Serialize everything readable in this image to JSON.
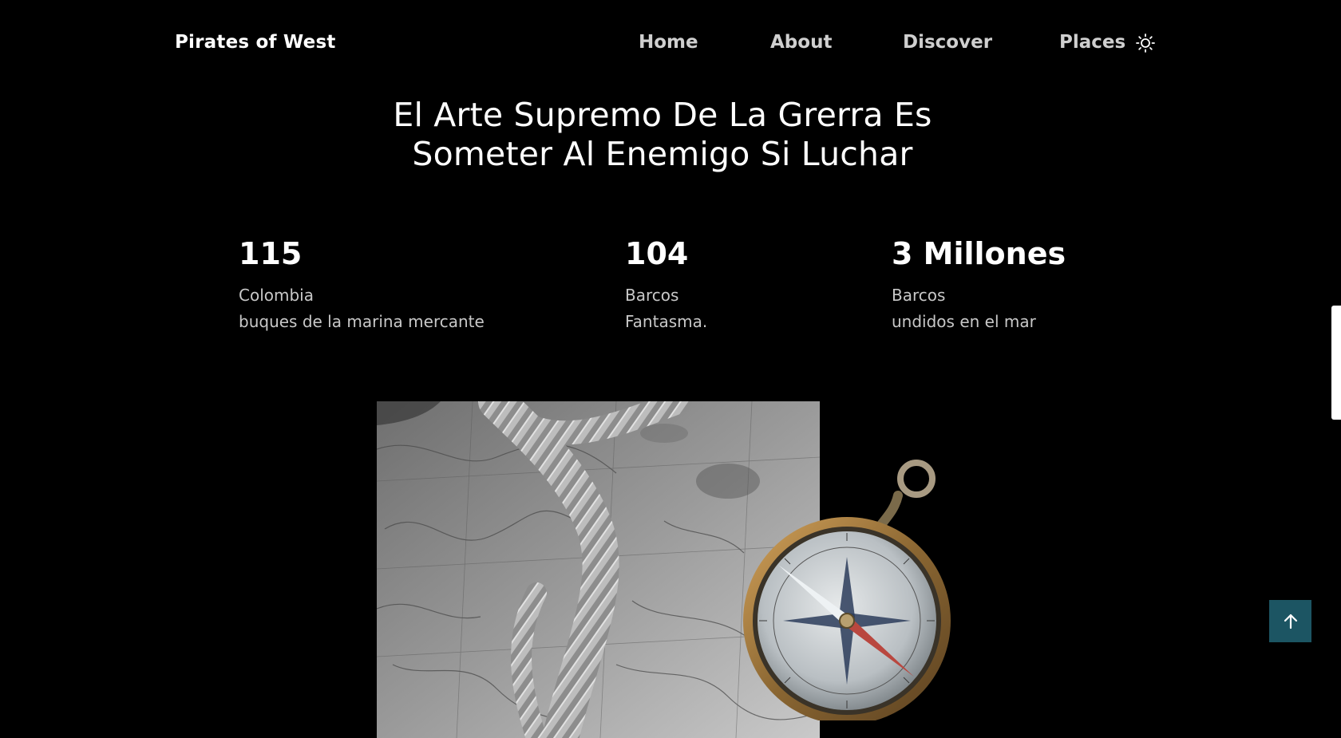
{
  "header": {
    "logo": "Pirates of West",
    "nav": {
      "home": "Home",
      "about": "About",
      "discover": "Discover",
      "places": "Places"
    },
    "theme_icon": "sun-icon"
  },
  "hero": {
    "title_line1": "El Arte Supremo De La Grerra Es",
    "title_line2": "Someter Al Enemigo Si Luchar"
  },
  "stats": [
    {
      "value": "115",
      "line1": "Colombia",
      "line2": "buques de la marina mercante"
    },
    {
      "value": "104",
      "line1": "Barcos",
      "line2": "Fantasma."
    },
    {
      "value": "3 Millones",
      "line1": "Barcos",
      "line2": "undidos en el mar"
    }
  ],
  "images": {
    "map": "map-with-rope-image",
    "compass": "compass-image"
  },
  "scroll_top_icon": "arrow-up-icon",
  "colors": {
    "background": "#000000",
    "text": "#ffffff",
    "muted_text": "#c8c8c8",
    "accent": "#1c5563"
  }
}
